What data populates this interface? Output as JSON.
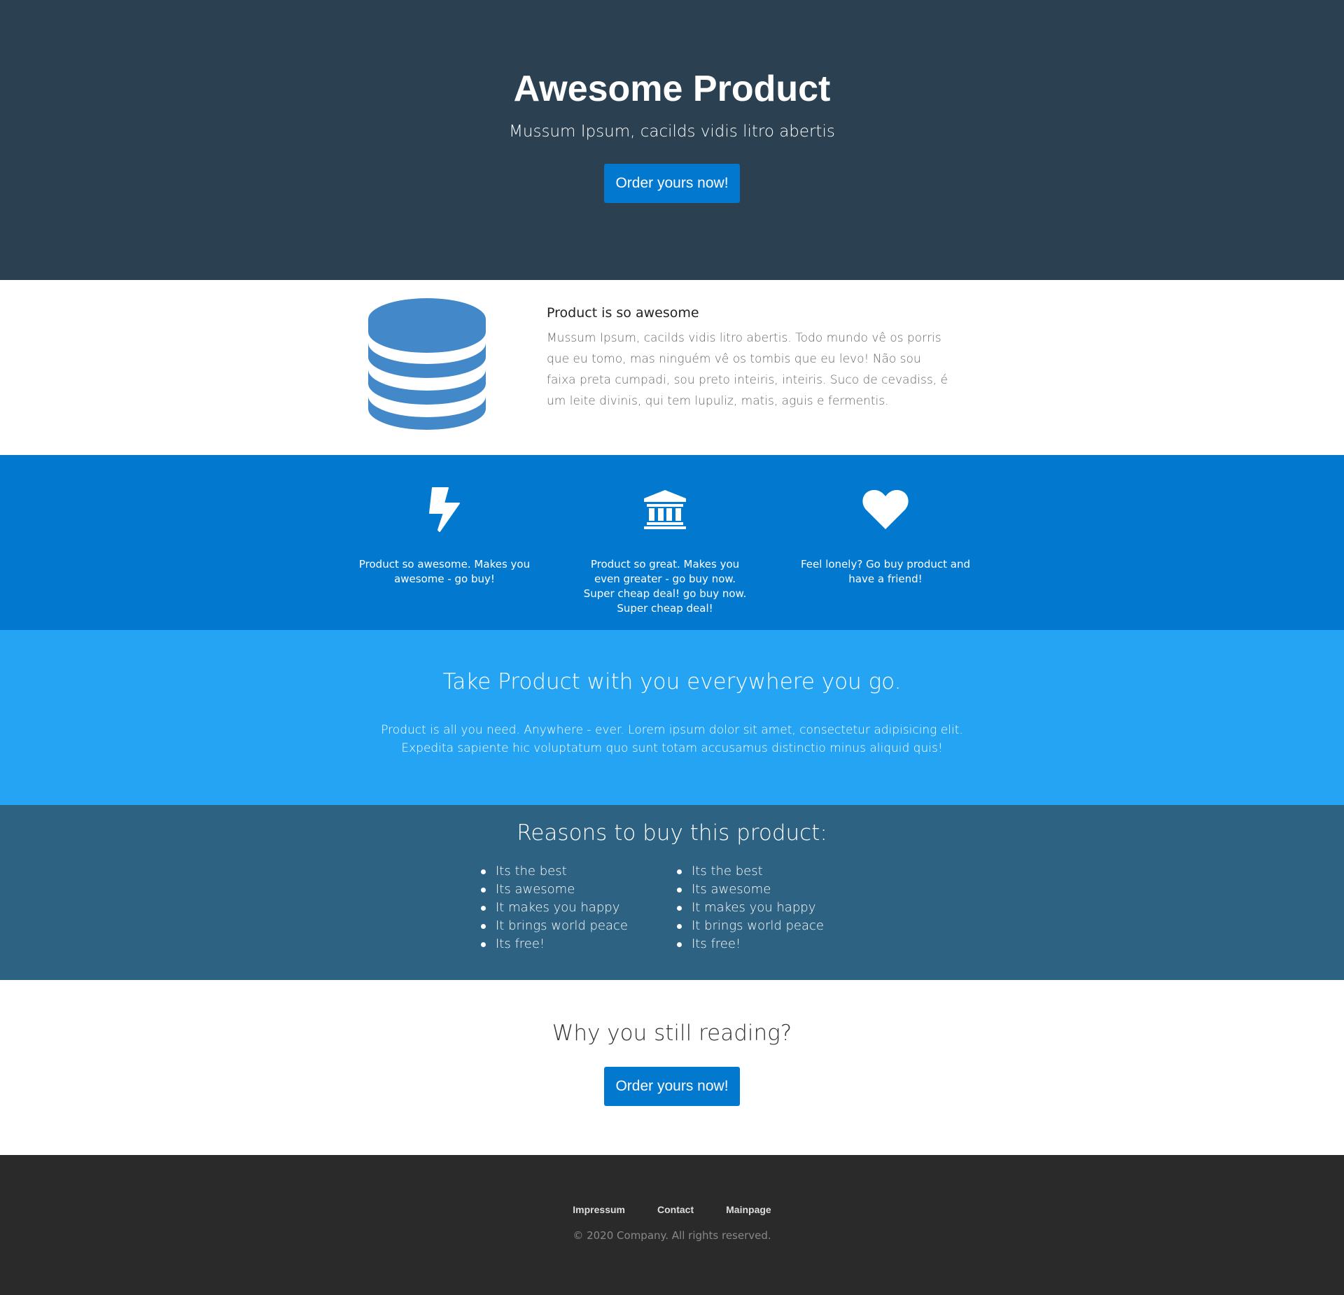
{
  "hero": {
    "title": "Awesome Product",
    "subtitle": "Mussum Ipsum, cacilds vidis litro abertis",
    "button_label": "Order yours now!"
  },
  "feature": {
    "icon": "database-icon",
    "heading": "Product is so awesome",
    "body": "Mussum Ipsum, cacilds vidis litro abertis. Todo mundo vê os porris que eu tomo, mas ninguém vê os tombis que eu levo! Não sou faixa preta cumpadi, sou preto inteiris, inteiris. Suco de cevadiss, é um leite divinis, qui tem lupuliz, matis, aguis e fermentis."
  },
  "icon_row": {
    "items": [
      {
        "icon": "lightning-bolt-icon",
        "text": "Product so awesome. Makes you awesome - go buy!"
      },
      {
        "icon": "bank-building-icon",
        "text": "Product so great. Makes you even greater - go buy now. Super cheap deal! go buy now. Super cheap deal!"
      },
      {
        "icon": "heart-icon",
        "text": "Feel lonely? Go buy product and have a friend!"
      }
    ]
  },
  "take": {
    "heading": "Take Product with you everywhere you go.",
    "body": "Product is all you need. Anywhere - ever. Lorem ipsum dolor sit amet, consectetur adipisicing elit. Expedita sapiente hic voluptatum quo sunt totam accusamus distinctio minus aliquid quis!"
  },
  "reasons": {
    "heading": "Reasons to buy this product:",
    "list_left": [
      "Its the best",
      "Its awesome",
      "It makes you happy",
      "It brings world peace",
      "Its free!"
    ],
    "list_right": [
      "Its the best",
      "Its awesome",
      "It makes you happy",
      "It brings world peace",
      "Its free!"
    ]
  },
  "cta": {
    "heading": "Why you still reading?",
    "button_label": "Order yours now!"
  },
  "footer": {
    "links": [
      "Impressum",
      "Contact",
      "Mainpage"
    ],
    "copyright": "© 2020 Company. All rights reserved."
  },
  "colors": {
    "hero_bg": "#2b4151",
    "primary_blue": "#0279cf",
    "light_blue": "#25a4f3",
    "reasons_bg": "#2e6282",
    "footer_bg": "#2a2a2a",
    "database_icon": "#4388c8"
  }
}
